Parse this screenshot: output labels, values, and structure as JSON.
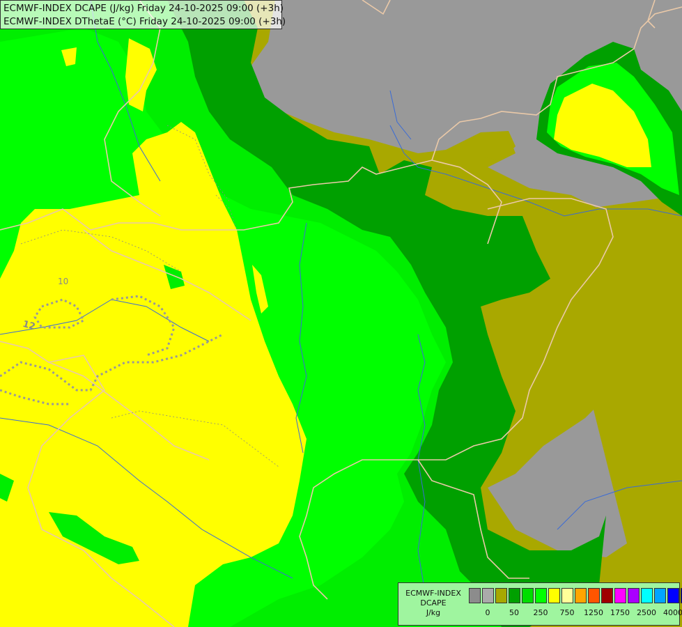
{
  "header": {
    "line1": "ECMWF-INDEX DCAPE (J/kg) Friday 24-10-2025 09:00 (+3h)",
    "line2": "ECMWF-INDEX DThetaE (°C) Friday 24-10-2025 09:00 (+3h)"
  },
  "contour_labels": [
    "10",
    "12"
  ],
  "legend": {
    "model": "ECMWF-INDEX",
    "parameter": "DCAPE",
    "unit": "J/kg",
    "colors": [
      "#8c8c8c",
      "#aaaaaa",
      "#a8a800",
      "#00a000",
      "#00dd00",
      "#00ff00",
      "#ffff00",
      "#ffff99",
      "#ffa500",
      "#ff5500",
      "#a00000",
      "#ff00ff",
      "#aa00ff",
      "#00ffff",
      "#00a5ff",
      "#0000ff",
      "#00008b"
    ],
    "tick_labels": [
      "0",
      "50",
      "250",
      "750",
      "1250",
      "1750",
      "2500",
      "4000"
    ]
  },
  "colors": {
    "grey": "#999999",
    "olive": "#a9a800",
    "dark_green": "#00a000",
    "green": "#00ee00",
    "light_green": "#00ff00",
    "yellow": "#ffff00",
    "border": "#eac9a8",
    "river": "#3a6bd6"
  }
}
